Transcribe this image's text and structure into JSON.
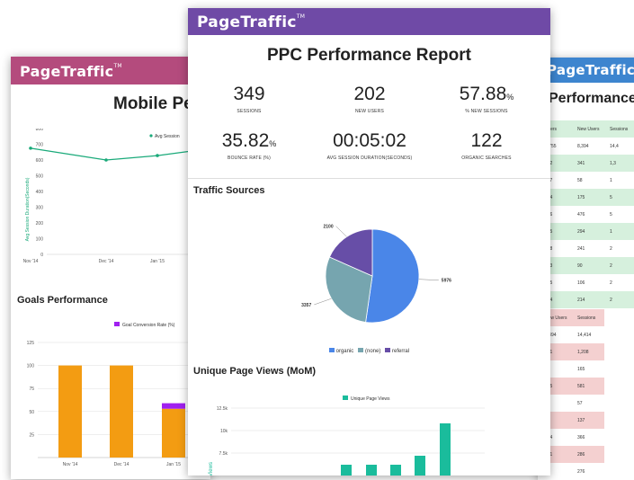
{
  "brand": "PageTraffic",
  "left_card": {
    "title": "Mobile Pe",
    "line_legend": "Avg Session",
    "line_ylabel": "Avg Session Duration(Seconds)",
    "line_yticks": [
      "800",
      "700",
      "600",
      "500",
      "400",
      "300",
      "200",
      "100",
      "0"
    ],
    "line_xticks": [
      "Nov '14",
      "Dec '14",
      "Jan '15"
    ],
    "goals_title": "Goals Performance",
    "goals_legend": "Goal Conversion Rate (%)",
    "goals_yticks": [
      "125",
      "100",
      "75",
      "50",
      "25"
    ],
    "goals_xticks": [
      "Nov '14",
      "Dec '14",
      "Jan '15"
    ]
  },
  "main_card": {
    "title": "PPC Performance Report",
    "metrics": [
      {
        "value": "349",
        "unit": "",
        "label": "SESSIONS"
      },
      {
        "value": "202",
        "unit": "",
        "label": "NEW USERS"
      },
      {
        "value": "57.88",
        "unit": "%",
        "label": "% NEW SESSIONS"
      },
      {
        "value": "35.82",
        "unit": "%",
        "label": "BOUNCE RATE (%)"
      },
      {
        "value": "00:05:02",
        "unit": "",
        "label": "AVG SESSION DURATION(SECONDS)"
      },
      {
        "value": "122",
        "unit": "",
        "label": "ORGANIC SEARCHES"
      }
    ],
    "traffic_title": "Traffic Sources",
    "upv_title": "Unique Page Views (MoM)",
    "upv_legend": "Unique Page Views",
    "upv_ylabel": "Views",
    "upv_yticks": [
      "12.5k",
      "10k",
      "7.5k"
    ]
  },
  "right_card": {
    "title": "Performance",
    "table1_headers": [
      "Users",
      "New Users",
      "Sessions"
    ],
    "table1_rows": [
      [
        "8,755",
        "8,394",
        "14,4"
      ],
      [
        "582",
        "341",
        "1,3"
      ],
      [
        "287",
        "58",
        "1"
      ],
      [
        "414",
        "175",
        "5"
      ],
      [
        "486",
        "476",
        "5"
      ],
      [
        "335",
        "294",
        "1"
      ],
      [
        "278",
        "241",
        "2"
      ],
      [
        "193",
        "90",
        "2"
      ],
      [
        "215",
        "106",
        "2"
      ],
      [
        "224",
        "214",
        "2"
      ]
    ],
    "table2_headers": [
      "New Users",
      "Sessions"
    ],
    "table2_rows": [
      [
        "8,394",
        "14,414"
      ],
      [
        "341",
        "1,208"
      ],
      [
        "81",
        "165"
      ],
      [
        "175",
        "581"
      ],
      [
        "0",
        "57"
      ],
      [
        "3",
        "137"
      ],
      [
        "294",
        "366"
      ],
      [
        "241",
        "286"
      ],
      [
        "90",
        "276"
      ],
      [
        "106",
        "241"
      ]
    ]
  },
  "chart_data": [
    {
      "type": "line",
      "title": "",
      "series": [
        {
          "name": "Avg Session",
          "values": [
            675,
            600,
            628,
            660
          ]
        }
      ],
      "categories": [
        "Nov '14",
        "Dec '14",
        "Jan '15",
        ""
      ],
      "ylabel": "Avg Session Duration(Seconds)",
      "ylim": [
        0,
        800
      ]
    },
    {
      "type": "bar",
      "title": "Goals Performance",
      "categories": [
        "Nov '14",
        "Dec '14",
        "Jan '15"
      ],
      "series": [
        {
          "name": "Goal Conversion Rate (%)",
          "values": [
            100,
            100,
            53
          ],
          "extra": [
            0,
            0,
            6
          ]
        }
      ],
      "ylim": [
        0,
        125
      ]
    },
    {
      "type": "pie",
      "title": "Traffic Sources",
      "labels": [
        "organic",
        "(none)",
        "referral"
      ],
      "values": [
        5976,
        3357,
        2100
      ],
      "colors": [
        "#4a86e8",
        "#76a5af",
        "#674ea7"
      ]
    },
    {
      "type": "bar",
      "title": "Unique Page Views (MoM)",
      "series": [
        {
          "name": "Unique Page Views",
          "values": [
            4200,
            6200,
            6200,
            6200,
            7200,
            10800
          ]
        }
      ],
      "ylabel": "Views",
      "ylim": [
        5000,
        12500
      ]
    }
  ]
}
